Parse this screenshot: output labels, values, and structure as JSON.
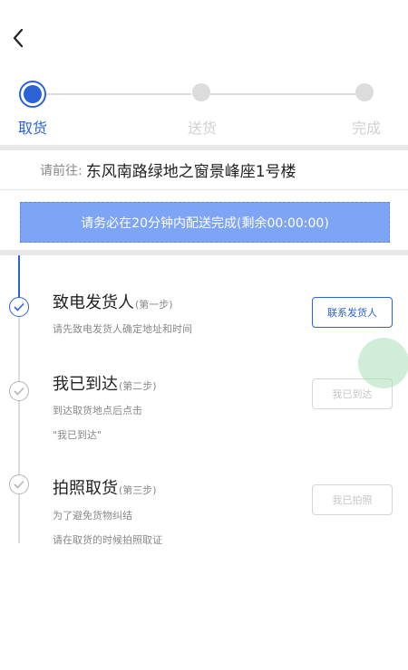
{
  "progress": {
    "steps": [
      {
        "label": "取货",
        "state": "active"
      },
      {
        "label": "送货",
        "state": "idle"
      },
      {
        "label": "完成",
        "state": "idle"
      }
    ]
  },
  "destination": {
    "prefix": "请前往:",
    "address": "东风南路绿地之窗景峰座1号楼"
  },
  "banner": {
    "text": "请务必在20分钟内配送完成(剩余00:00:00)"
  },
  "steps": [
    {
      "title": "致电发货人",
      "sub": "(第一步)",
      "desc": [
        "请先致电发货人确定地址和时间"
      ],
      "button": "联系发货人",
      "done": true
    },
    {
      "title": "我已到达",
      "sub": "(第二步)",
      "desc": [
        "到达取货地点后点击",
        "\"我已到达\""
      ],
      "button": "我已到达",
      "done": false
    },
    {
      "title": "拍照取货",
      "sub": "(第三步)",
      "desc": [
        "为了避免货物纠结",
        "请在取货的时候拍照取证"
      ],
      "button": "我已拍照",
      "done": false
    }
  ],
  "colors": {
    "accent": "#2b63d6",
    "banner": "#7ea4f6",
    "muted": "#888888",
    "disabled": "#c5c5c5"
  }
}
